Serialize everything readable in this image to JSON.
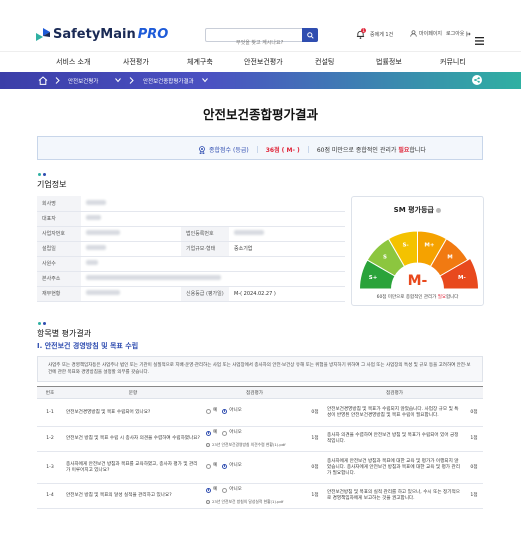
{
  "header": {
    "logo_main": "SafetyMain",
    "logo_pro": "PRO",
    "search_placeholder": "무엇을 찾고 계시나요?",
    "notification_count": "1",
    "notification_text": "중에게 1건",
    "mypage": "마이페이지",
    "logout": "로그아웃"
  },
  "nav": {
    "items": [
      "서비스 소개",
      "사전평가",
      "체계구축",
      "안전보건평가",
      "컨설팅",
      "법률정보",
      "커뮤니티"
    ]
  },
  "breadcrumb": {
    "items": [
      "안전보건평가",
      "안전보건종합평가결과"
    ]
  },
  "page": {
    "title": "안전보건종합평가결과"
  },
  "summary": {
    "label": "종합점수 (등급)",
    "score": "36점 ( M- )",
    "text_before": "60점 미만으로 종합적인 관리가 ",
    "text_highlight": "필요",
    "text_after": "합니다"
  },
  "company": {
    "section_title": "기업정보",
    "labels": {
      "name": "회사명",
      "ceo": "대표자",
      "bizno": "사업자번호",
      "corpno": "법인등록번호",
      "founded": "설립일",
      "biztype": "기업규모·형태",
      "biztype_value": "중소기업",
      "employees": "사원수",
      "address": "본사주소",
      "capital": "재무현황",
      "credit": "신용등급 (평가일)",
      "credit_value": "M-( 2024.02.27 )"
    }
  },
  "grade": {
    "title": "SM 평가등급",
    "center": "M-",
    "segments": [
      "S+",
      "S",
      "S-",
      "M+",
      "M",
      "M-"
    ],
    "foot_before": "60점 미만으로 종합적인 관리가 ",
    "foot_highlight": "필요",
    "foot_after": "합니다"
  },
  "results": {
    "section_title": "항목별 평가결과",
    "subsection": "I. 안전보건 경영방침 및 목표 수립",
    "description": "사업주 또는 경영책임자등은 사업주나 법인 또는 기관이 실질적으로 지배·운영·관리하는 사업 또는 사업장에서 종사자의 안전·보건상 유해 또는 위험을 방지하기 위하여 그 사업 또는 사업장의 특성 및 규모 등을 고려하여 안전·보건에 관한 목표와 경영방침을 설정할 의무를 갖습니다.",
    "headers": [
      "번호",
      "문항",
      "점검평가",
      "",
      "점검평가"
    ],
    "yes": "예",
    "no": "아니오",
    "rows": [
      {
        "no": "1-1",
        "question": "안전보건경영방침 및 목표 수립되어 있나요?",
        "answer": "no",
        "file": "",
        "score": "0점",
        "comment": "안전보건경영방침 및 목표가 수립되지 않았습니다. 사업장 규모 및 특성이 반영된 안전보건경영방침 및 목표 수립이 필요합니다.",
        "score2": "0점"
      },
      {
        "no": "1-2",
        "question": "안전보건 방침 및 목표 수립 시 종사자 의견을 수렴하여 수립하였나요?",
        "answer": "yes",
        "file": "23년 안전보건경영방침 의견수렴 현황(1).pdf",
        "score": "1점",
        "comment": "종사자 의견을 수렴하여 안전보건 방침 및 목표가 수립되어 있어 긍정적입니다.",
        "score2": "1점"
      },
      {
        "no": "1-3",
        "question": "종사자에게 안전보건 방침과 목표를 교육하였고, 종사자 평가 및 관리가 이루어지고 있나요?",
        "answer": "no",
        "file": "",
        "score": "0점",
        "comment": "종사자에게 안전보건 방침과 목표에 대한 교육 및 평가가 이행되지 않았습니다. 종사자에게 안전보건 방침과 목표에 대한 교육 및 평가 관리가 필요합니다.",
        "score2": "0점"
      },
      {
        "no": "1-4",
        "question": "안전보건 방침 및 목표의 달성 실적을 관리하고 있나요?",
        "answer": "yes",
        "file": "23년 안전보건 방침의 달성실적 현황(1).pdf",
        "score": "1점",
        "comment": "안전보건방침 및 목표의 실적 관리를 하고 있으나, 수시 또는 정기적으로 경영책임자에게 보고하는 것을 권고합니다.",
        "score2": "1점"
      }
    ]
  },
  "colors": {
    "primary": "#2f4db0",
    "highlight": "#e0263a",
    "gauge": [
      "#2aa33a",
      "#8cc63f",
      "#f4c200",
      "#f5a200",
      "#f17a12",
      "#e8491d"
    ]
  }
}
